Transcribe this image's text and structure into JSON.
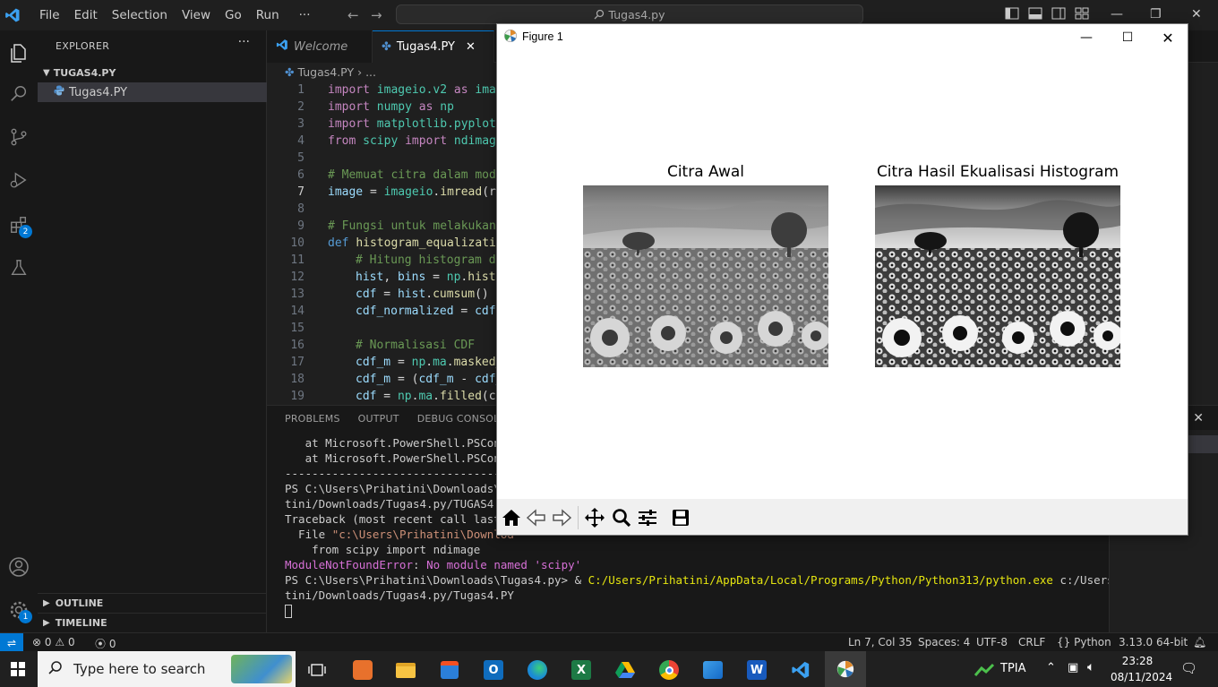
{
  "titlebar": {
    "menu": [
      "File",
      "Edit",
      "Selection",
      "View",
      "Go",
      "Run"
    ],
    "more": "···",
    "search_text": "Tugas4.py"
  },
  "sidebar": {
    "title": "EXPLORER",
    "folder": "TUGAS4.PY",
    "file": "Tugas4.PY",
    "outline": "OUTLINE",
    "timeline": "TIMELINE",
    "extensions_badge": "2",
    "account_badge": "1"
  },
  "tabs": {
    "welcome": "Welcome",
    "file": "Tugas4.PY"
  },
  "breadcrumb": {
    "file": "Tugas4.PY",
    "rest": "..."
  },
  "code": {
    "l1": [
      "import",
      "imageio.v2",
      "as",
      "imag"
    ],
    "l2": [
      "import",
      "numpy",
      "as",
      "np"
    ],
    "l3": [
      "import",
      "matplotlib.pyplot"
    ],
    "l4": [
      "from",
      "scipy",
      "import",
      "ndimage"
    ],
    "l6": "# Memuat citra dalam mode",
    "l7": [
      "image",
      " = ",
      "imageio",
      ".",
      "imread",
      "(r"
    ],
    "l9": "# Fungsi untuk melakukan",
    "l10": [
      "def",
      "histogram_equalizatio"
    ],
    "l11": "# Hitung histogram da",
    "l12": [
      "hist",
      ", ",
      "bins",
      " = ",
      "np",
      ".",
      "histo"
    ],
    "l13": [
      "cdf",
      " = ",
      "hist",
      ".",
      "cumsum",
      "()"
    ],
    "l14": [
      "cdf_normalized",
      " = ",
      "cdf"
    ],
    "l16": "# Normalisasi CDF",
    "l17": [
      "cdf_m",
      " = ",
      "np",
      ".",
      "ma",
      ".",
      "masked_"
    ],
    "l18": [
      "cdf_m",
      " = (",
      "cdf_m",
      " - ",
      "cdf_"
    ],
    "l19": [
      "cdf",
      " = ",
      "np",
      ".",
      "ma",
      ".",
      "filled",
      "(co"
    ]
  },
  "panel": {
    "tabs": [
      "PROBLEMS",
      "OUTPUT",
      "DEBUG CONSOLE"
    ],
    "lines": {
      "t1": "   at Microsoft.PowerShell.PSConso",
      "t2": "   at Microsoft.PowerShell.PSConso",
      "t3": "-----------------------------------",
      "t4": "PS C:\\Users\\Prihatini\\Downloads\\Tu",
      "t5": "tini/Downloads/Tugas4.py/TUGAS4.PY",
      "t6": "Traceback (most recent call last):",
      "t7a": "  File ",
      "t7b": "\"c:\\Users\\Prihatini\\Downloa",
      "t8": "    from scipy import ndimage",
      "t9a": "ModuleNotFoundError",
      "t9b": ": ",
      "t9c": "No module named 'scipy'",
      "t10a": "PS C:\\Users\\Prihatini\\Downloads\\Tugas4.py> & ",
      "t10b": "C:/Users/Prihatini/AppData/Local/Programs/Python/Python313/python.exe",
      "t10c": " c:/Users/Priha",
      "t11": "tini/Downloads/Tugas4.py/Tugas4.PY"
    }
  },
  "statusbar": {
    "errors": "0",
    "warnings": "0",
    "ports": "0",
    "position": "Ln 7, Col 35",
    "spaces": "Spaces: 4",
    "encoding": "UTF-8",
    "eol": "CRLF",
    "language": "Python",
    "interpreter": "3.13.0 64-bit"
  },
  "figure": {
    "window_title": "Figure 1",
    "ax1_title": "Citra Awal",
    "ax2_title": "Citra Hasil Ekualisasi Histogram"
  },
  "taskbar": {
    "search_placeholder": "Type here to search",
    "tray_label": "TPIA",
    "time": "23:28",
    "date": "08/11/2024"
  },
  "colors": {
    "accent": "#0078d4",
    "editor_bg": "#1f1f1f",
    "sidebar_bg": "#181818"
  }
}
